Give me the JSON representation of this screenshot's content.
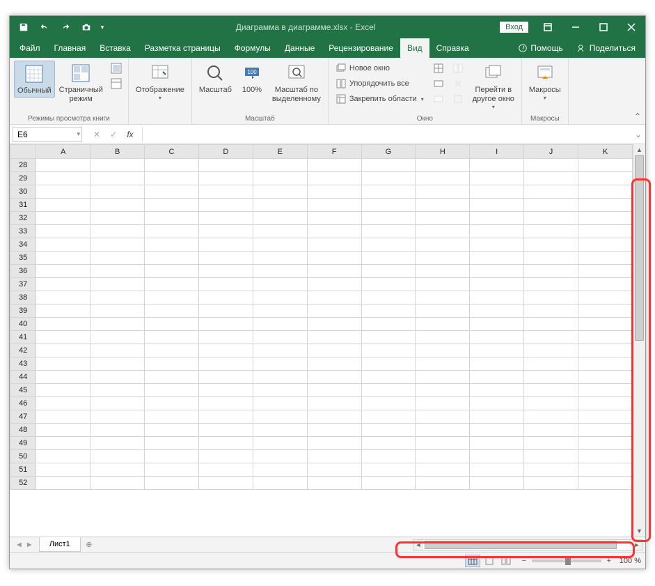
{
  "titlebar": {
    "title": "Диаграмма в диаграмме.xlsx - Excel",
    "login_label": "Вход"
  },
  "tabs": {
    "file": "Файл",
    "home": "Главная",
    "insert": "Вставка",
    "pagelayout": "Разметка страницы",
    "formulas": "Формулы",
    "data": "Данные",
    "review": "Рецензирование",
    "view": "Вид",
    "help": "Справка",
    "tellme": "Помощь",
    "share": "Поделиться"
  },
  "ribbon": {
    "group_views": "Режимы просмотра книги",
    "normal": "Обычный",
    "page_break": "Страничный\nрежим",
    "display": "Отображение",
    "group_zoom": "Масштаб",
    "zoom": "Масштаб",
    "zoom100": "100%",
    "zoom_selection": "Масштаб по\nвыделенному",
    "new_window": "Новое окно",
    "arrange_all": "Упорядочить все",
    "freeze_panes": "Закрепить области",
    "group_window": "Окно",
    "switch_windows": "Перейти в\nдругое окно",
    "macros": "Макросы",
    "group_macros": "Макросы"
  },
  "namebox": {
    "value": "E6"
  },
  "columns": [
    "A",
    "B",
    "C",
    "D",
    "E",
    "F",
    "G",
    "H",
    "I",
    "J",
    "K"
  ],
  "rows": [
    28,
    29,
    30,
    31,
    32,
    33,
    34,
    35,
    36,
    37,
    38,
    39,
    40,
    41,
    42,
    43,
    44,
    45,
    46,
    47,
    48,
    49,
    50,
    51,
    52
  ],
  "sheet": {
    "tab1": "Лист1"
  },
  "statusbar": {
    "zoom": "100 %"
  }
}
